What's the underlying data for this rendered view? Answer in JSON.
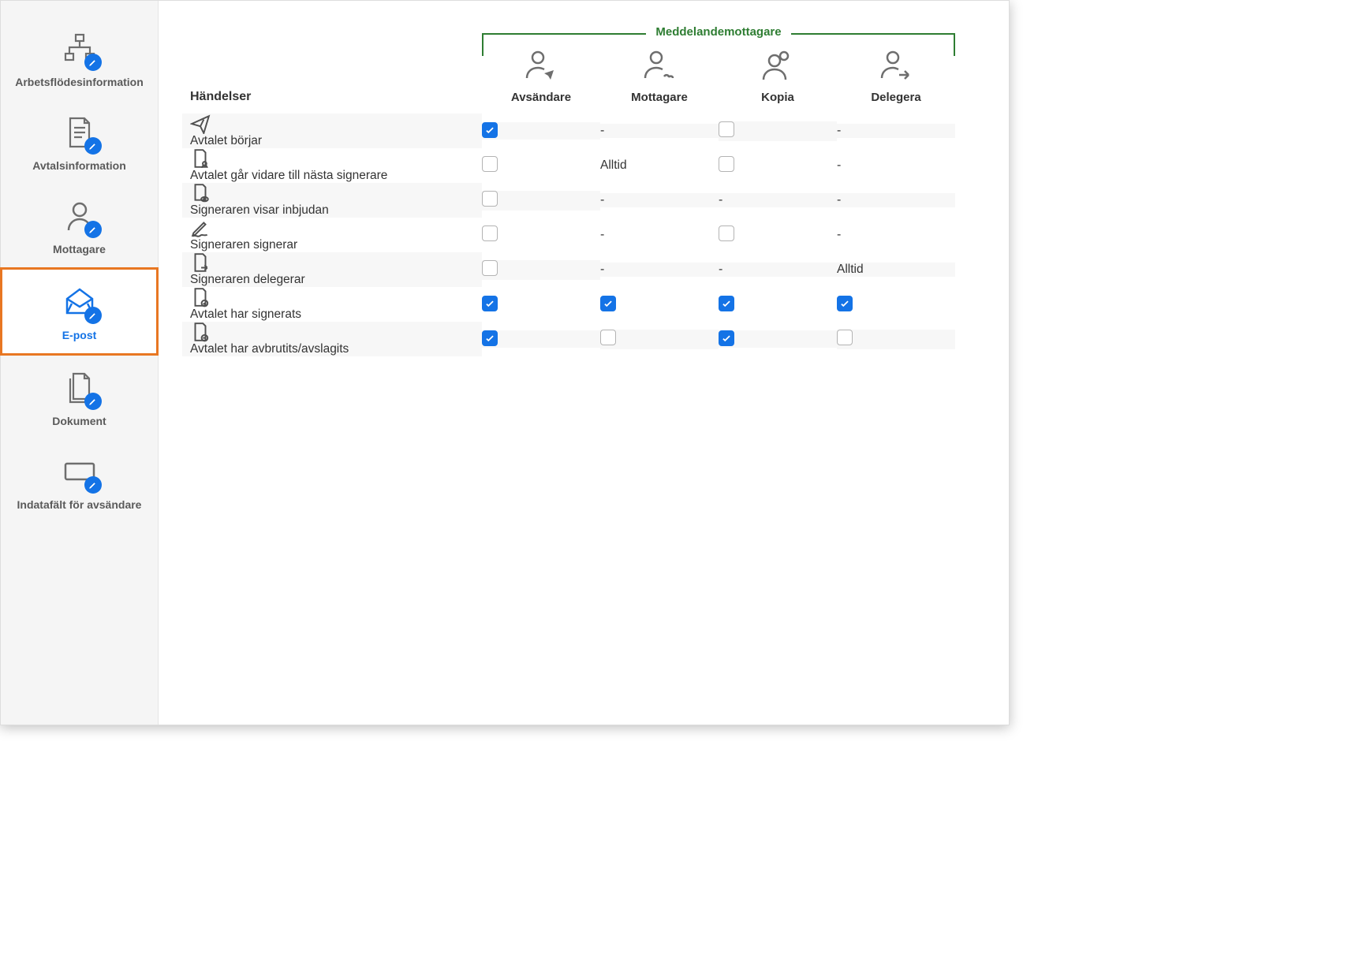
{
  "sidebar": {
    "items": [
      {
        "label": "Arbetsflödesinformation",
        "id": "workflow-info",
        "active": false
      },
      {
        "label": "Avtalsinformation",
        "id": "agreement-info",
        "active": false
      },
      {
        "label": "Mottagare",
        "id": "recipients",
        "active": false
      },
      {
        "label": "E-post",
        "id": "email",
        "active": true
      },
      {
        "label": "Dokument",
        "id": "documents",
        "active": false
      },
      {
        "label": "Indatafält för avsändare",
        "id": "sender-input-fields",
        "active": false
      }
    ]
  },
  "table": {
    "events_heading": "Händelser",
    "group_heading": "Meddelandemottagare",
    "columns": [
      {
        "label": "Avsändare",
        "id": "sender"
      },
      {
        "label": "Mottagare",
        "id": "recipient"
      },
      {
        "label": "Kopia",
        "id": "cc"
      },
      {
        "label": "Delegera",
        "id": "delegate"
      }
    ],
    "text_always": "Alltid",
    "text_dash": "-",
    "rows": [
      {
        "label": "Avtalet börjar",
        "icon": "paper-plane",
        "cells": [
          {
            "type": "checkbox",
            "checked": true
          },
          {
            "type": "text",
            "value": "-"
          },
          {
            "type": "checkbox",
            "checked": false
          },
          {
            "type": "text",
            "value": "-"
          }
        ]
      },
      {
        "label": "Avtalet går vidare till nästa signerare",
        "icon": "doc-person",
        "cells": [
          {
            "type": "checkbox",
            "checked": false
          },
          {
            "type": "text",
            "value": "Alltid"
          },
          {
            "type": "checkbox",
            "checked": false
          },
          {
            "type": "text",
            "value": "-"
          }
        ]
      },
      {
        "label": "Signeraren visar inbjudan",
        "icon": "doc-eye",
        "cells": [
          {
            "type": "checkbox",
            "checked": false
          },
          {
            "type": "text",
            "value": "-"
          },
          {
            "type": "text",
            "value": "-"
          },
          {
            "type": "text",
            "value": "-"
          }
        ]
      },
      {
        "label": "Signeraren signerar",
        "icon": "pen",
        "cells": [
          {
            "type": "checkbox",
            "checked": false
          },
          {
            "type": "text",
            "value": "-"
          },
          {
            "type": "checkbox",
            "checked": false
          },
          {
            "type": "text",
            "value": "-"
          }
        ]
      },
      {
        "label": "Signeraren delegerar",
        "icon": "doc-arrow",
        "cells": [
          {
            "type": "checkbox",
            "checked": false
          },
          {
            "type": "text",
            "value": "-"
          },
          {
            "type": "text",
            "value": "-"
          },
          {
            "type": "text",
            "value": "Alltid"
          }
        ]
      },
      {
        "label": "Avtalet har signerats",
        "icon": "doc-check",
        "cells": [
          {
            "type": "checkbox",
            "checked": true
          },
          {
            "type": "checkbox",
            "checked": true
          },
          {
            "type": "checkbox",
            "checked": true
          },
          {
            "type": "checkbox",
            "checked": true
          }
        ]
      },
      {
        "label": "Avtalet har avbrutits/avslagits",
        "icon": "doc-minus",
        "cells": [
          {
            "type": "checkbox",
            "checked": true
          },
          {
            "type": "checkbox",
            "checked": false
          },
          {
            "type": "checkbox",
            "checked": true
          },
          {
            "type": "checkbox",
            "checked": false
          }
        ]
      }
    ]
  }
}
